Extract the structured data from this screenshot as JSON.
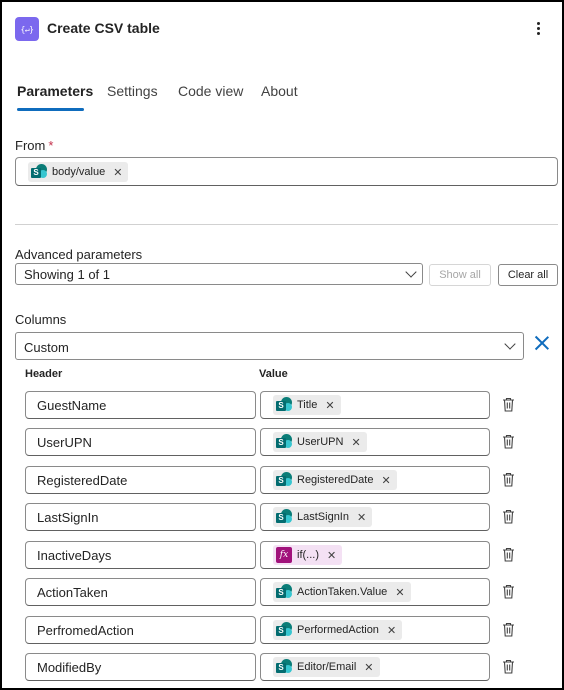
{
  "header": {
    "title": "Create CSV table",
    "app_icon": "data-operation-icon",
    "app_icon_glyph": "{↵}",
    "accent_color": "#7b68ee"
  },
  "tabs": [
    {
      "label": "Parameters",
      "active": true
    },
    {
      "label": "Settings",
      "active": false
    },
    {
      "label": "Code view",
      "active": false
    },
    {
      "label": "About",
      "active": false
    }
  ],
  "from": {
    "label": "From",
    "required_marker": "*",
    "token": {
      "label": "body/value",
      "icon": "sharepoint-icon"
    }
  },
  "advanced": {
    "label": "Advanced parameters",
    "select_value": "Showing 1 of 1",
    "show_all_label": "Show all",
    "clear_all_label": "Clear all"
  },
  "columns": {
    "label": "Columns",
    "select_value": "Custom",
    "header_col": "Header",
    "value_col": "Value",
    "rows": [
      {
        "header": "GuestName",
        "value": "Title",
        "icon": "sharepoint-icon"
      },
      {
        "header": "UserUPN",
        "value": "UserUPN",
        "icon": "sharepoint-icon"
      },
      {
        "header": "RegisteredDate",
        "value": "RegisteredDate",
        "icon": "sharepoint-icon"
      },
      {
        "header": "LastSignIn",
        "value": "LastSignIn",
        "icon": "sharepoint-icon"
      },
      {
        "header": "InactiveDays",
        "value": "if(...)",
        "icon": "expression-icon"
      },
      {
        "header": "ActionTaken",
        "value": "ActionTaken.Value",
        "icon": "sharepoint-icon"
      },
      {
        "header": "PerfromedAction",
        "value": "PerformedAction",
        "icon": "sharepoint-icon"
      },
      {
        "header": "ModifiedBy",
        "value": "Editor/Email",
        "icon": "sharepoint-icon"
      }
    ]
  },
  "colors": {
    "primary": "#0f6cbd",
    "required": "#c4314b",
    "sharepoint": "#036c70",
    "expression": "#a1127b"
  }
}
